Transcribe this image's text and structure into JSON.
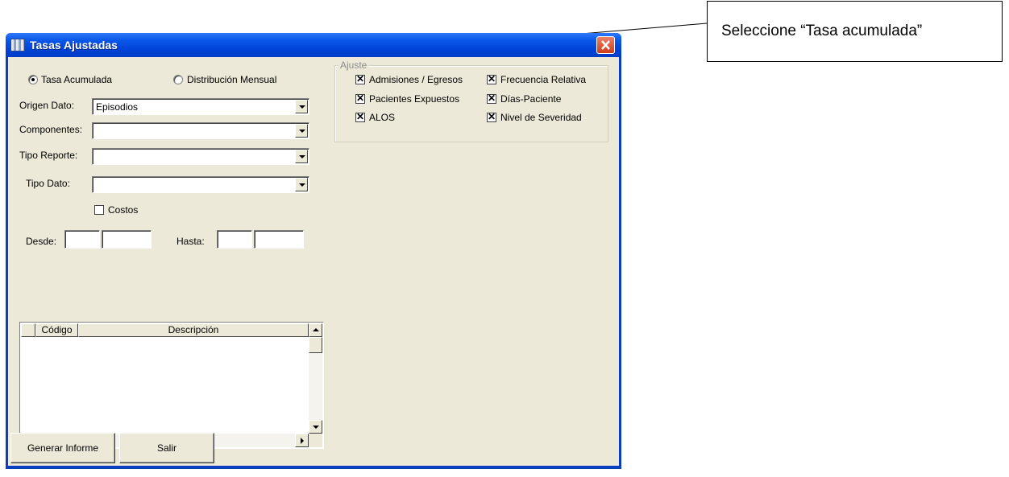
{
  "window": {
    "title": "Tasas Ajustadas"
  },
  "report_mode": {
    "options": [
      {
        "label": "Tasa Acumulada",
        "selected": true
      },
      {
        "label": "Distribución Mensual",
        "selected": false
      }
    ]
  },
  "fields": {
    "origen_dato": {
      "label": "Origen Dato:",
      "value": "Episodios"
    },
    "componentes": {
      "label": "Componentes:",
      "value": ""
    },
    "tipo_reporte": {
      "label": "Tipo Reporte:",
      "value": ""
    },
    "tipo_dato": {
      "label": "Tipo Dato:",
      "value": ""
    },
    "costos": {
      "label": "Costos",
      "checked": false
    },
    "desde": {
      "label": "Desde:"
    },
    "hasta": {
      "label": "Hasta:"
    }
  },
  "ajuste": {
    "legend": "Ajuste",
    "items": [
      {
        "label": "Admisiones / Egresos",
        "checked": true
      },
      {
        "label": "Frecuencia Relativa",
        "checked": true
      },
      {
        "label": "Pacientes Expuestos",
        "checked": true
      },
      {
        "label": "Días-Paciente",
        "checked": true
      },
      {
        "label": "ALOS",
        "checked": true
      },
      {
        "label": "Nivel de Severidad",
        "checked": true
      }
    ]
  },
  "grid": {
    "columns": [
      "Código",
      "Descripción"
    ],
    "rows": []
  },
  "buttons": {
    "generar_informe": "Generar Informe",
    "salir": "Salir"
  },
  "callout": {
    "text": "Seleccione “Tasa acumulada”"
  },
  "colors": {
    "titlebar": "#0a58e8",
    "window_bg": "#ece9d8",
    "close_button": "#cc3c1c"
  }
}
